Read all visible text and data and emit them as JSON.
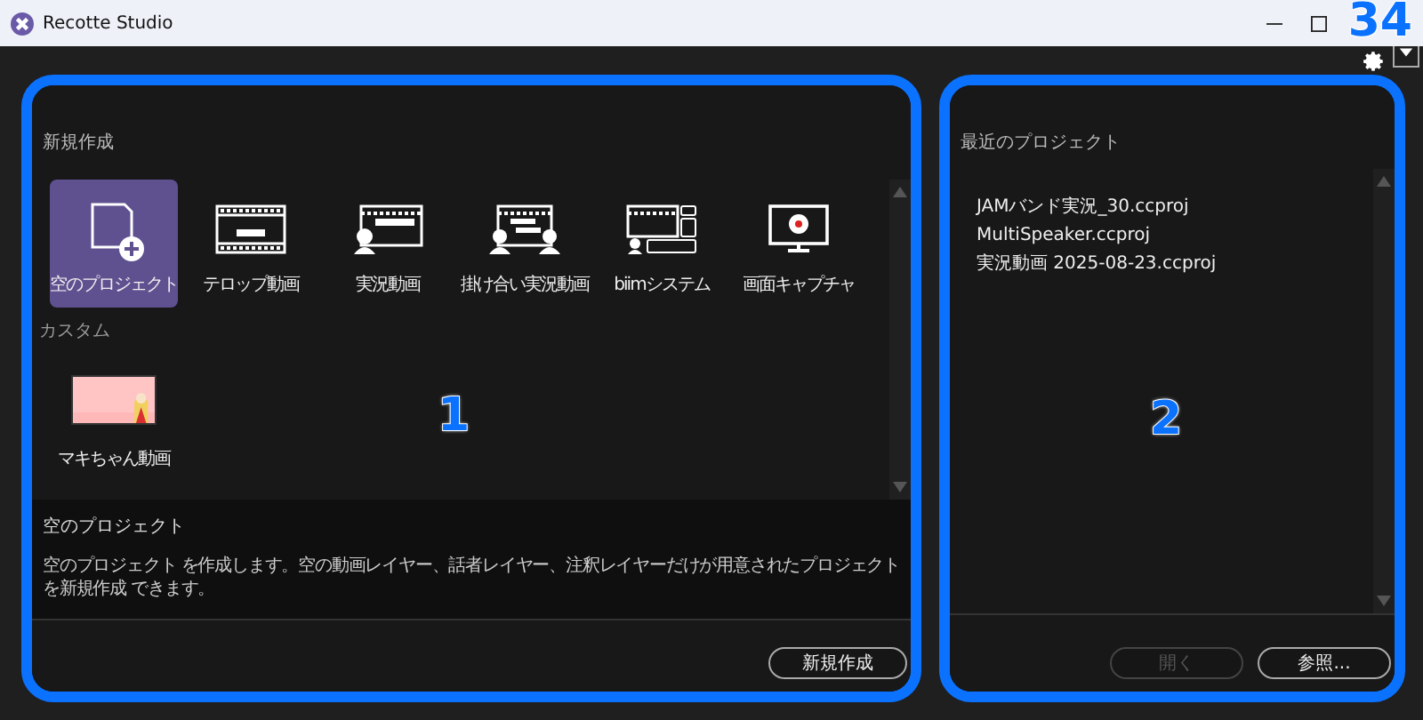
{
  "window": {
    "title": "Recotte Studio",
    "callout": "34"
  },
  "new_project": {
    "heading": "新規作成",
    "callout": "1",
    "groups": [
      {
        "items": [
          {
            "kind": "blank",
            "label": "空のプロジェクト",
            "selected": true
          },
          {
            "kind": "telop",
            "label": "テロップ動画",
            "selected": false
          },
          {
            "kind": "commentary",
            "label": "実況動画",
            "selected": false
          },
          {
            "kind": "duo",
            "label": "掛け合い実況動画",
            "selected": false
          },
          {
            "kind": "biim",
            "label": "biimシステム",
            "selected": false
          },
          {
            "kind": "capture",
            "label": "画面キャプチャ",
            "selected": false
          }
        ]
      },
      {
        "header": "カスタム",
        "items": [
          {
            "kind": "picture",
            "label": "マキちゃん動画",
            "selected": false
          }
        ]
      }
    ],
    "description": {
      "title": "空のプロジェクト",
      "text": "空のプロジェクト を作成します。空の動画レイヤー、話者レイヤー、注釈レイヤーだけが用意されたプロジェクトを新規作成 できます。"
    },
    "button": "新規作成"
  },
  "recent": {
    "heading": "最近のプロジェクト",
    "callout": "2",
    "files": [
      "JAMバンド実況_30.ccproj",
      "MultiSpeaker.ccproj",
      "実況動画 2025-08-23.ccproj"
    ],
    "buttons": [
      {
        "label": "開く",
        "disabled": true
      },
      {
        "label": "参照...",
        "disabled": false
      }
    ]
  }
}
